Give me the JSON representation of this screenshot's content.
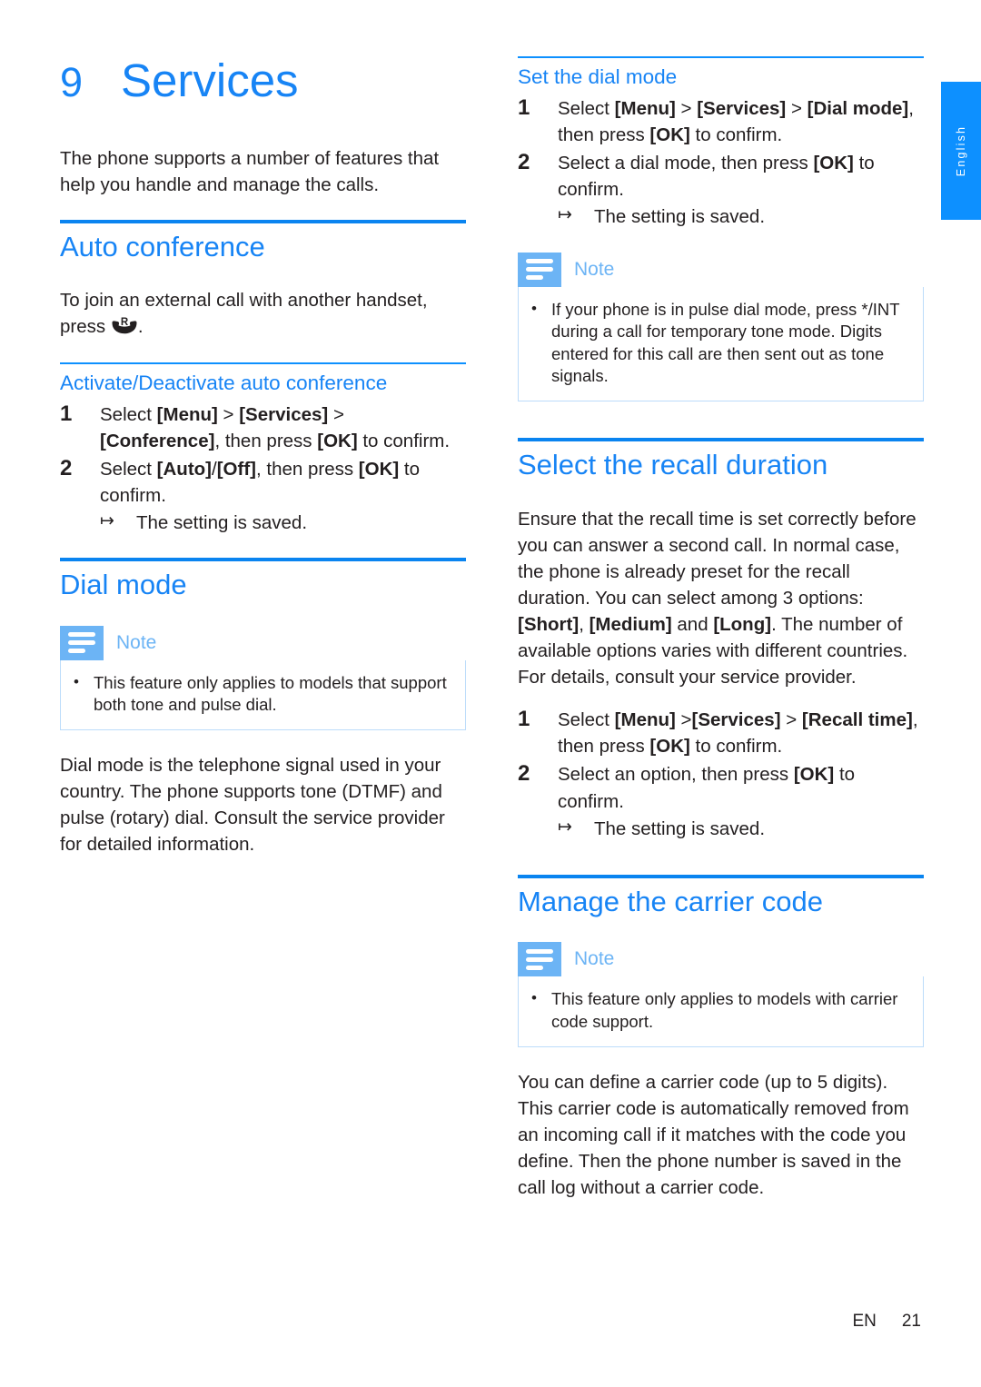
{
  "language_tab": {
    "label": "English"
  },
  "chapter": {
    "number": "9",
    "title": "Services"
  },
  "footer": {
    "lang_code": "EN",
    "page_number": "21"
  },
  "left_column": {
    "intro": "The phone supports a number of features that help you handle and manage the calls.",
    "auto_conference": {
      "heading": "Auto conference",
      "intro_before_icon": "To join an external call with another handset, press",
      "icon_name": "handset-recall-icon",
      "icon_superscript": "R",
      "intro_after_icon": ".",
      "subsection": {
        "heading": "Activate/Deactivate auto conference",
        "steps": [
          {
            "number": "1",
            "text": "Select [Menu] > [Services] > [Conference], then press [OK] to confirm."
          },
          {
            "number": "2",
            "text": "Select [Auto]/[Off], then press [OK] to confirm.",
            "result": "The setting is saved."
          }
        ]
      }
    },
    "dial_mode": {
      "heading": "Dial mode",
      "note": {
        "label": "Note",
        "items": [
          "This feature only applies to models that support both tone and pulse dial."
        ]
      },
      "body": "Dial mode is the telephone signal used in your country. The phone supports tone (DTMF) and pulse (rotary) dial. Consult the service provider for detailed information."
    }
  },
  "right_column": {
    "set_dial_mode": {
      "heading": "Set the dial mode",
      "steps": [
        {
          "number": "1",
          "text": "Select [Menu] > [Services] > [Dial mode], then press [OK] to confirm."
        },
        {
          "number": "2",
          "text": "Select a dial mode, then press [OK] to confirm.",
          "result": "The setting is saved."
        }
      ],
      "note": {
        "label": "Note",
        "items": [
          "If your phone is in pulse dial mode, press */INT during a call for temporary tone mode. Digits entered for this call are then sent out as tone signals."
        ]
      }
    },
    "recall_duration": {
      "heading": "Select the recall duration",
      "body": "Ensure that the recall time is set correctly before you can answer a second call. In normal case, the phone is already preset for the recall duration. You can select among 3 options: [Short], [Medium] and [Long]. The number of available options varies with different countries. For details, consult your service provider.",
      "steps": [
        {
          "number": "1",
          "text": "Select [Menu] >[Services] > [Recall time], then press [OK] to confirm."
        },
        {
          "number": "2",
          "text": "Select an option, then press [OK] to confirm.",
          "result": "The setting is saved."
        }
      ]
    },
    "carrier_code": {
      "heading": "Manage the carrier code",
      "note": {
        "label": "Note",
        "items": [
          "This feature only applies to models with carrier code support."
        ]
      },
      "body": "You can define a carrier code (up to 5 digits). This carrier code is automatically removed from an incoming call if it matches with the code you define. Then the phone number is saved in the call log without a carrier code."
    }
  },
  "colors": {
    "heading_blue": "#1784f5",
    "rule_blue": "#0a84f0",
    "tab_blue": "#0d90ff",
    "note_blue": "#6cb4f5",
    "note_border": "#bcdcfa",
    "text_black": "#231f20"
  }
}
